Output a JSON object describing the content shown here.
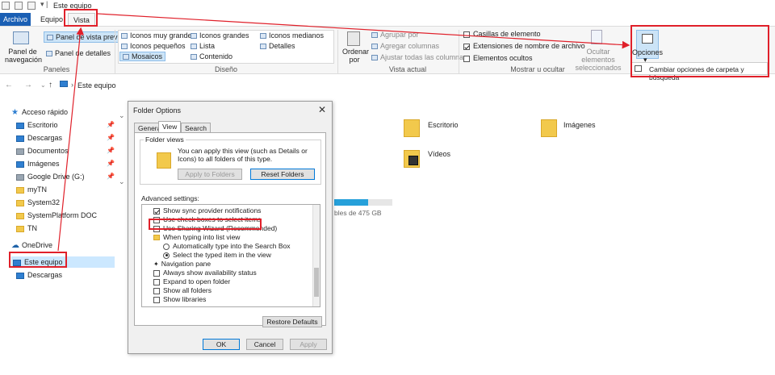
{
  "window": {
    "title": "Este equipo"
  },
  "tabs": [
    {
      "label": "Archivo"
    },
    {
      "label": "Equipo"
    },
    {
      "label": "Vista"
    }
  ],
  "ribbon": {
    "panes": {
      "nav_pane": "Panel de navegación",
      "preview_pane": "Panel de vista previa",
      "details_pane": "Panel de detalles",
      "group_label": "Paneles"
    },
    "layout": {
      "items": [
        "Iconos muy grandes",
        "Iconos grandes",
        "Iconos medianos",
        "Iconos pequeños",
        "Lista",
        "Detalles",
        "Mosaicos",
        "Contenido"
      ],
      "group_label": "Diseño"
    },
    "current_view": {
      "sort": "Ordenar por",
      "group_by": "Agrupar por",
      "add_columns": "Agregar columnas",
      "fit_columns": "Ajustar todas las columnas",
      "group_label": "Vista actual"
    },
    "show_hide": {
      "item_checkboxes": "Casillas de elemento",
      "file_extensions": "Extensiones de nombre de archivo",
      "hidden_items": "Elementos ocultos",
      "hide_selected": "Ocultar elementos seleccionados",
      "group_label": "Mostrar u ocultar"
    },
    "options": {
      "label": "Opciones",
      "dropdown_item": "Cambiar opciones de carpeta y búsqueda"
    }
  },
  "address": {
    "path": "Este equipo"
  },
  "sidebar": {
    "items": [
      {
        "label": "Acceso rápido"
      },
      {
        "label": "Escritorio"
      },
      {
        "label": "Descargas"
      },
      {
        "label": "Documentos"
      },
      {
        "label": "Imágenes"
      },
      {
        "label": "Google Drive (G:)"
      },
      {
        "label": "myTN"
      },
      {
        "label": "System32"
      },
      {
        "label": "SystemPlatform DOC"
      },
      {
        "label": "TN"
      },
      {
        "label": "OneDrive"
      },
      {
        "label": "Este equipo"
      },
      {
        "label": "Descargas"
      }
    ]
  },
  "content": {
    "folders": [
      {
        "label": "Escritorio"
      },
      {
        "label": "Imágenes"
      },
      {
        "label": "Vídeos"
      }
    ],
    "drive_free": "bles de 475 GB"
  },
  "dialog": {
    "title": "Folder Options",
    "tabs": [
      "General",
      "View",
      "Search"
    ],
    "folder_views": {
      "legend": "Folder views",
      "text": "You can apply this view (such as Details or Icons) to all folders of this type.",
      "apply_btn": "Apply to Folders",
      "reset_btn": "Reset Folders"
    },
    "advanced_label": "Advanced settings:",
    "advanced": [
      "Show sync provider notifications",
      "Use check boxes to select items",
      "Use Sharing Wizard (Recommended)",
      "When typing into list view",
      "Automatically type into the Search Box",
      "Select the typed item in the view",
      "Navigation pane",
      "Always show availability status",
      "Expand to open folder",
      "Show all folders",
      "Show libraries"
    ],
    "restore_btn": "Restore Defaults",
    "ok": "OK",
    "cancel": "Cancel",
    "apply": "Apply"
  },
  "colors": {
    "annotation": "#e0202a",
    "accent": "#1a5fb4"
  }
}
